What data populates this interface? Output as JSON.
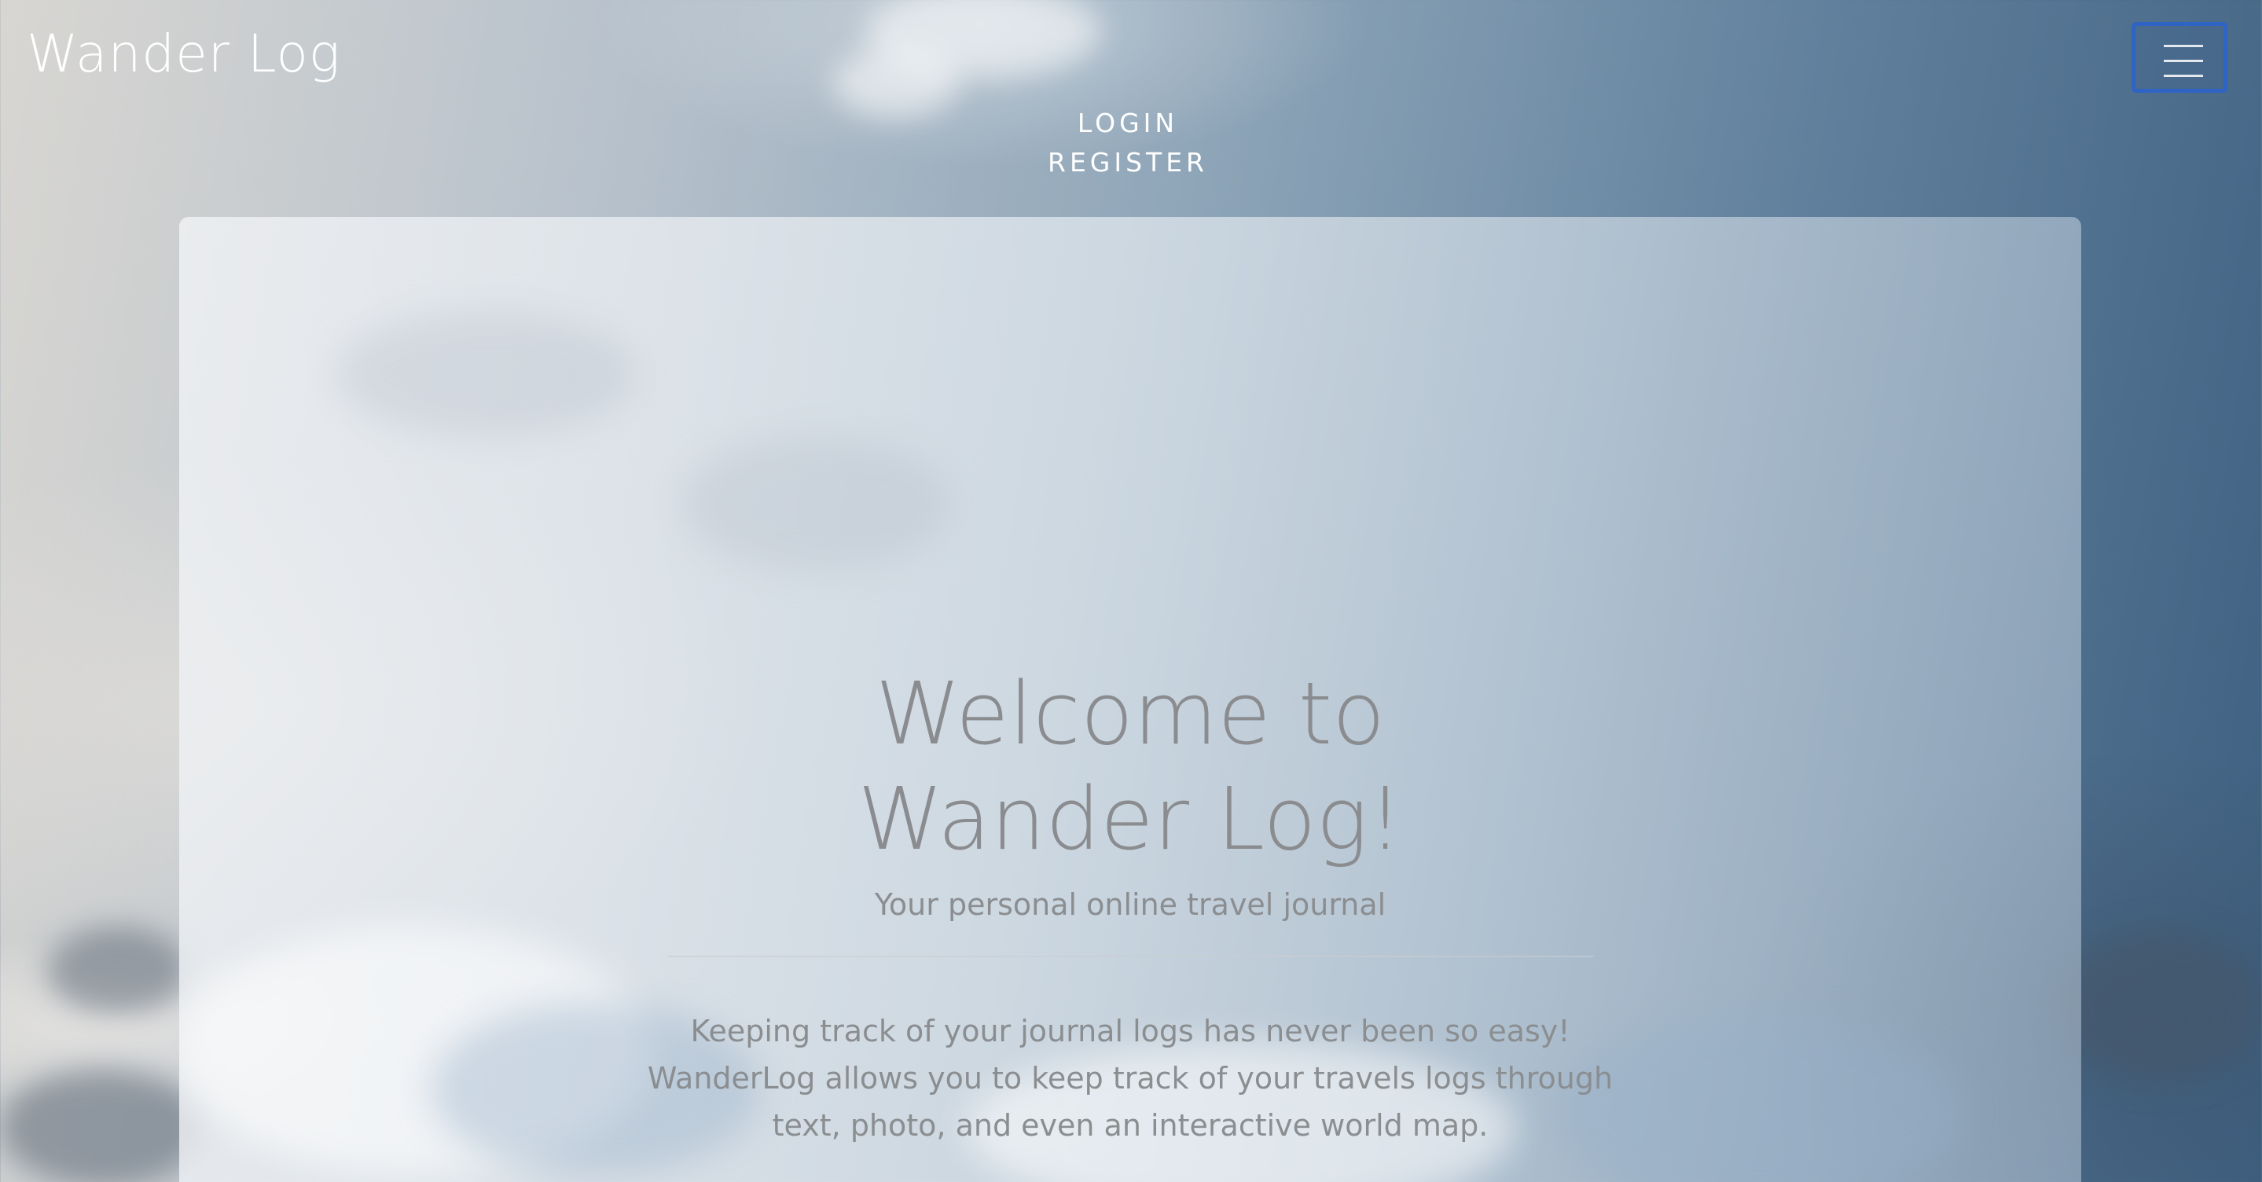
{
  "brand": {
    "name": "Wander Log"
  },
  "nav": {
    "toggler_icon": "hamburger-menu-icon",
    "links": [
      {
        "label": "LOGIN"
      },
      {
        "label": "REGISTER"
      }
    ]
  },
  "hero": {
    "title": "Welcome to Wander Log!",
    "subtitle": "Your personal online travel journal",
    "body": "Keeping track of your journal logs has never been so easy! WanderLog allows you to keep track of your travels logs through text, photo, and even an interactive world map."
  },
  "colors": {
    "toggler_focus_border": "#2f64c4",
    "nav_text": "#ffffff",
    "hero_text": "#8a8c8f"
  }
}
